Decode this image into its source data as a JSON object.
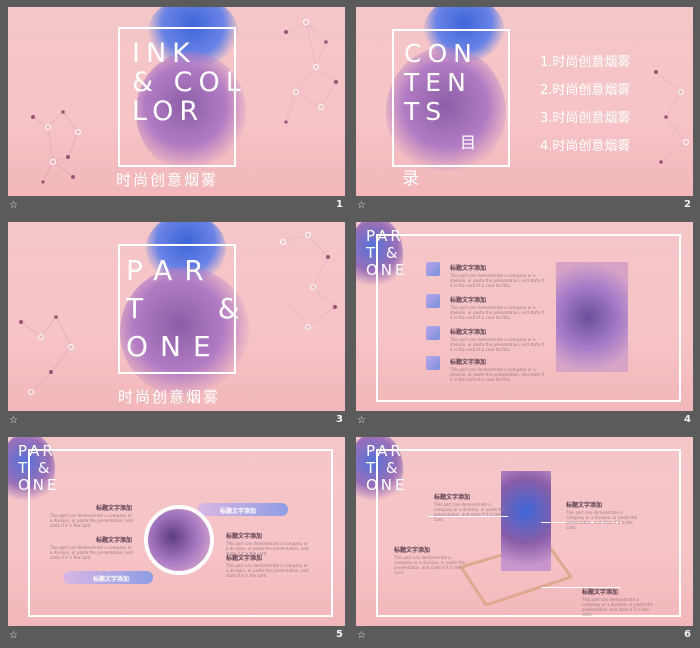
{
  "colors": {
    "background": "#5b5b5b",
    "slide_bg": "#f4c6c8",
    "accent_blue": "#7d8fe0",
    "ink_purple": "#8a5ea0"
  },
  "slides": [
    {
      "number": "1",
      "star": "☆",
      "title_lines": "INK\n& COL\nLOR",
      "subtitle": "时尚创意烟雾"
    },
    {
      "number": "2",
      "star": "☆",
      "title_lines": "CON\nTEN\nTS",
      "title_suffix": "目",
      "title_suffix2": "录",
      "items": [
        "1.时尚创意烟雾",
        "2.时尚创意烟雾",
        "3.时尚创意烟雾",
        "4.时尚创意烟雾"
      ]
    },
    {
      "number": "3",
      "star": "☆",
      "title_lines": "PAR\nT   &\nONE",
      "subtitle": "时尚创意烟雾"
    },
    {
      "number": "4",
      "star": "☆",
      "corner_lines": "PAR\nT &\nONE",
      "entries": [
        {
          "title": "标题文字添加",
          "desc": "This part can demonstrate a company or a division, or paste the presentation, and state if it is the card of a case for this."
        },
        {
          "title": "标题文字添加",
          "desc": "This part can demonstrate a company or a division, or paste the presentation, and state if it is the card of a case for this."
        },
        {
          "title": "标题文字添加",
          "desc": "This part can demonstrate a company or a division, or paste the presentation, and state if it is the card of a case for this."
        },
        {
          "title": "标题文字添加",
          "desc": "This part can demonstrate a company or a division, or paste the presentation, and state if it is the card of a case for this."
        }
      ]
    },
    {
      "number": "5",
      "star": "☆",
      "corner_lines": "PAR\nT &\nONE",
      "entries": [
        {
          "title": "标题文字添加",
          "desc": "This part can demonstrate a company or a division, or paste the presentation, and state if it is the card."
        },
        {
          "title": "标题文字添加",
          "desc": "This part can demonstrate a company or a division, or paste the presentation, and state if it is the card."
        },
        {
          "title": "标题文字添加",
          "desc": "This part can demonstrate a company or a division, or paste the presentation, and state if it is the card."
        },
        {
          "title": "标题文字添加",
          "desc": "This part can demonstrate a company or a division, or paste the presentation, and state if it is the card."
        }
      ],
      "pill_labels": [
        "标题文字添加",
        "标题文字添加"
      ]
    },
    {
      "number": "6",
      "star": "☆",
      "corner_lines": "PAR\nT &\nONE",
      "entries": [
        {
          "title": "标题文字添加",
          "desc": "This part can demonstrate a company or a division, or paste the presentation, and state if it is the card."
        },
        {
          "title": "标题文字添加",
          "desc": "This part can demonstrate a company or a division, or paste the presentation, and state if it is the card."
        },
        {
          "title": "标题文字添加",
          "desc": "This part can demonstrate a company or a division, or paste the presentation, and state if it is the card."
        },
        {
          "title": "标题文字添加",
          "desc": "This part can demonstrate a company or a division, or paste the presentation, and state if it is the card."
        }
      ]
    }
  ]
}
